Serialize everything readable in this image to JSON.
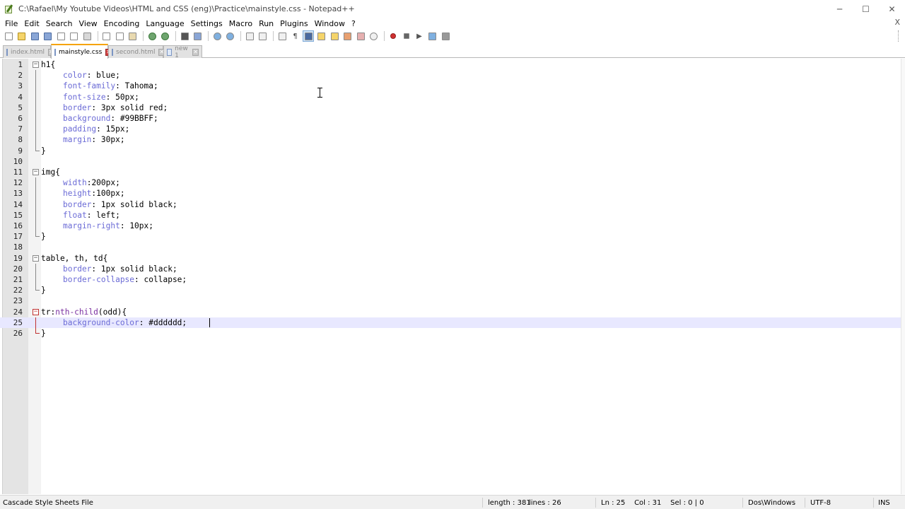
{
  "window": {
    "title": "C:\\Rafael\\My Youtube Videos\\HTML and CSS (eng)\\Practice\\mainstyle.css - Notepad++",
    "controls": {
      "minimize": "─",
      "maximize": "☐",
      "close": "✕"
    }
  },
  "menu": {
    "items": [
      "File",
      "Edit",
      "Search",
      "View",
      "Encoding",
      "Language",
      "Settings",
      "Macro",
      "Run",
      "Plugins",
      "Window",
      "?"
    ],
    "close_doc": "X"
  },
  "tabs": [
    {
      "label": "index.html",
      "active": false
    },
    {
      "label": "mainstyle.css",
      "active": true
    },
    {
      "label": "second.html",
      "active": false
    },
    {
      "label": "new 1",
      "active": false
    }
  ],
  "editor": {
    "current_line": 25,
    "lines": [
      {
        "n": "1",
        "tokens": [
          [
            "sel",
            "h1"
          ],
          [
            "punct",
            "{"
          ]
        ]
      },
      {
        "n": "2",
        "tokens": [
          [
            "indent",
            ""
          ],
          [
            "prop",
            "color"
          ],
          [
            "punct",
            ": "
          ],
          [
            "val",
            "blue"
          ],
          [
            "punct",
            ";"
          ]
        ]
      },
      {
        "n": "3",
        "tokens": [
          [
            "indent",
            ""
          ],
          [
            "prop",
            "font-family"
          ],
          [
            "punct",
            ": "
          ],
          [
            "val",
            "Tahoma"
          ],
          [
            "punct",
            ";"
          ]
        ]
      },
      {
        "n": "4",
        "tokens": [
          [
            "indent",
            ""
          ],
          [
            "prop",
            "font-size"
          ],
          [
            "punct",
            ": "
          ],
          [
            "val",
            "50px"
          ],
          [
            "punct",
            ";"
          ]
        ]
      },
      {
        "n": "5",
        "tokens": [
          [
            "indent",
            ""
          ],
          [
            "prop",
            "border"
          ],
          [
            "punct",
            ": "
          ],
          [
            "val",
            "3px solid red"
          ],
          [
            "punct",
            ";"
          ]
        ]
      },
      {
        "n": "6",
        "tokens": [
          [
            "indent",
            ""
          ],
          [
            "prop",
            "background"
          ],
          [
            "punct",
            ": "
          ],
          [
            "val",
            "#99BBFF"
          ],
          [
            "punct",
            ";"
          ]
        ]
      },
      {
        "n": "7",
        "tokens": [
          [
            "indent",
            ""
          ],
          [
            "prop",
            "padding"
          ],
          [
            "punct",
            ": "
          ],
          [
            "val",
            "15px"
          ],
          [
            "punct",
            ";"
          ]
        ]
      },
      {
        "n": "8",
        "tokens": [
          [
            "indent",
            ""
          ],
          [
            "prop",
            "margin"
          ],
          [
            "punct",
            ": "
          ],
          [
            "val",
            "30px"
          ],
          [
            "punct",
            ";"
          ]
        ]
      },
      {
        "n": "9",
        "tokens": [
          [
            "punct",
            "}"
          ]
        ]
      },
      {
        "n": "10",
        "tokens": []
      },
      {
        "n": "11",
        "tokens": [
          [
            "sel",
            "img"
          ],
          [
            "punct",
            "{"
          ]
        ]
      },
      {
        "n": "12",
        "tokens": [
          [
            "indent",
            ""
          ],
          [
            "prop",
            "width"
          ],
          [
            "punct",
            ":"
          ],
          [
            "val",
            "200px"
          ],
          [
            "punct",
            ";"
          ]
        ]
      },
      {
        "n": "13",
        "tokens": [
          [
            "indent",
            ""
          ],
          [
            "prop",
            "height"
          ],
          [
            "punct",
            ":"
          ],
          [
            "val",
            "100px"
          ],
          [
            "punct",
            ";"
          ]
        ]
      },
      {
        "n": "14",
        "tokens": [
          [
            "indent",
            ""
          ],
          [
            "prop",
            "border"
          ],
          [
            "punct",
            ": "
          ],
          [
            "val",
            "1px solid black"
          ],
          [
            "punct",
            ";"
          ]
        ]
      },
      {
        "n": "15",
        "tokens": [
          [
            "indent",
            ""
          ],
          [
            "prop",
            "float"
          ],
          [
            "punct",
            ": "
          ],
          [
            "val",
            "left"
          ],
          [
            "punct",
            ";"
          ]
        ]
      },
      {
        "n": "16",
        "tokens": [
          [
            "indent",
            ""
          ],
          [
            "prop",
            "margin-right"
          ],
          [
            "punct",
            ": "
          ],
          [
            "val",
            "10px"
          ],
          [
            "punct",
            ";"
          ]
        ]
      },
      {
        "n": "17",
        "tokens": [
          [
            "punct",
            "}"
          ]
        ]
      },
      {
        "n": "18",
        "tokens": []
      },
      {
        "n": "19",
        "tokens": [
          [
            "sel",
            "table, th, td"
          ],
          [
            "punct",
            "{"
          ]
        ]
      },
      {
        "n": "20",
        "tokens": [
          [
            "indent",
            ""
          ],
          [
            "prop",
            "border"
          ],
          [
            "punct",
            ": "
          ],
          [
            "val",
            "1px solid black"
          ],
          [
            "punct",
            ";"
          ]
        ]
      },
      {
        "n": "21",
        "tokens": [
          [
            "indent",
            ""
          ],
          [
            "prop",
            "border-collapse"
          ],
          [
            "punct",
            ": "
          ],
          [
            "val",
            "collapse"
          ],
          [
            "punct",
            ";"
          ]
        ]
      },
      {
        "n": "22",
        "tokens": [
          [
            "punct",
            "}"
          ]
        ]
      },
      {
        "n": "23",
        "tokens": []
      },
      {
        "n": "24",
        "tokens": [
          [
            "sel",
            "tr"
          ],
          [
            "punct",
            ":"
          ],
          [
            "pseudo",
            "nth-child"
          ],
          [
            "punct",
            "(odd){"
          ]
        ]
      },
      {
        "n": "25",
        "tokens": [
          [
            "indent",
            ""
          ],
          [
            "prop",
            "background-color"
          ],
          [
            "punct",
            ": "
          ],
          [
            "val",
            "#dddddd"
          ],
          [
            "punct",
            ";"
          ]
        ]
      },
      {
        "n": "26",
        "tokens": [
          [
            "punct",
            "}"
          ]
        ]
      }
    ]
  },
  "status": {
    "file_type": "Cascade Style Sheets File",
    "length": "length : 381",
    "lines": "lines : 26",
    "position": "Ln : 25    Col : 31    Sel : 0 | 0",
    "eol": "Dos\\Windows",
    "encoding": "UTF-8",
    "mode": "INS"
  },
  "colors": {
    "property": "#6b6bd6",
    "pseudo_class": "#7a2fa0",
    "active_tab_accent": "#f6a300",
    "current_line_bg": "#e8e8ff",
    "fold_marker_active": "#c03030"
  }
}
